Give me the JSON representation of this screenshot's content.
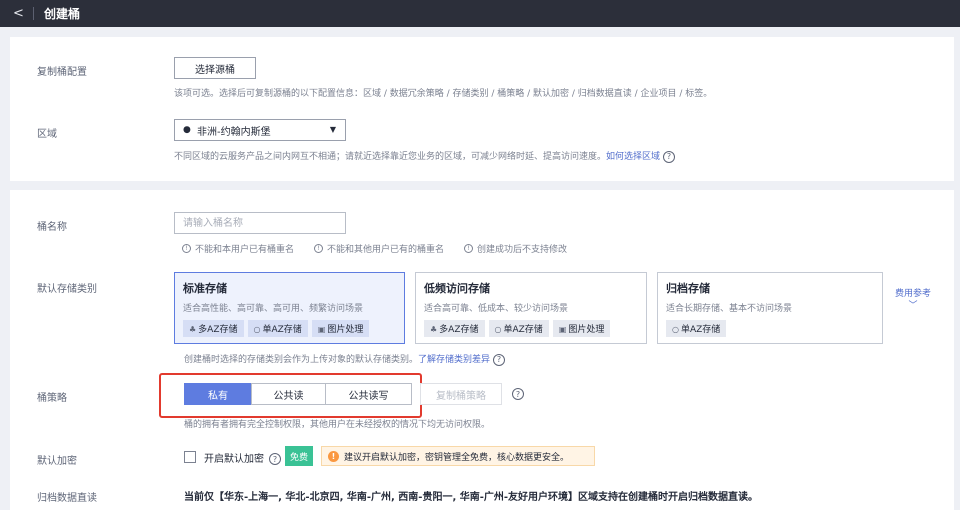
{
  "header": {
    "back_icon": "chevron-left-icon",
    "title": "创建桶"
  },
  "replication": {
    "label": "复制桶配置",
    "button_label": "选择源桶",
    "hint": "该项可选。选择后可复制源桶的以下配置信息：区域 / 数据冗余策略 / 存储类别 / 桶策略 / 默认加密 / 归档数据直读 / 企业项目 / 标签。"
  },
  "region": {
    "label": "区域",
    "selected": "非洲-约翰内斯堡",
    "hint": "不同区域的云服务产品之间内网互不相通；请就近选择靠近您业务的区域，可减少网络时延、提高访问速度。",
    "link": "如何选择区域"
  },
  "bucket_name": {
    "label": "桶名称",
    "placeholder": "请输入桶名称",
    "rules": [
      "不能和本用户已有桶重名",
      "不能和其他用户已有的桶重名",
      "创建成功后不支持修改"
    ]
  },
  "storage_class": {
    "label": "默认存储类别",
    "options": [
      {
        "title": "标准存储",
        "desc": "适合高性能、高可靠、高可用、频繁访问场景",
        "tags": [
          "多AZ存储",
          "单AZ存储",
          "图片处理"
        ],
        "selected": true
      },
      {
        "title": "低频访问存储",
        "desc": "适合高可靠、低成本、较少访问场景",
        "tags": [
          "多AZ存储",
          "单AZ存储",
          "图片处理"
        ],
        "selected": false
      },
      {
        "title": "归档存储",
        "desc": "适合长期存储、基本不访问场景",
        "tags": [
          "单AZ存储"
        ],
        "selected": false
      }
    ],
    "fee_ref": "费用参考",
    "hint": "创建桶时选择的存储类别会作为上传对象的默认存储类别。",
    "link": "了解存储类别差异"
  },
  "bucket_policy": {
    "label": "桶策略",
    "options": [
      "私有",
      "公共读",
      "公共读写",
      "复制桶策略"
    ],
    "active_index": 0,
    "hint": "桶的拥有者拥有完全控制权限，其他用户在未经授权的情况下均无访问权限。"
  },
  "encryption": {
    "label": "默认加密",
    "checkbox_label": "开启默认加密",
    "free_badge": "免费",
    "advice": "建议开启默认加密，密钥管理全免费，核心数据更安全。"
  },
  "archive_read": {
    "label": "归档数据直读",
    "note": "当前仅【华东-上海一, 华北-北京四, 华南-广州, 西南-贵阳一, 华南-广州-友好用户环境】区域支持在创建桶时开启归档数据直读。"
  },
  "colors": {
    "accent": "#5e7ce0",
    "highlight_border": "#e23a2e",
    "free_green": "#3ac295",
    "warning_orange": "#fa9841"
  }
}
